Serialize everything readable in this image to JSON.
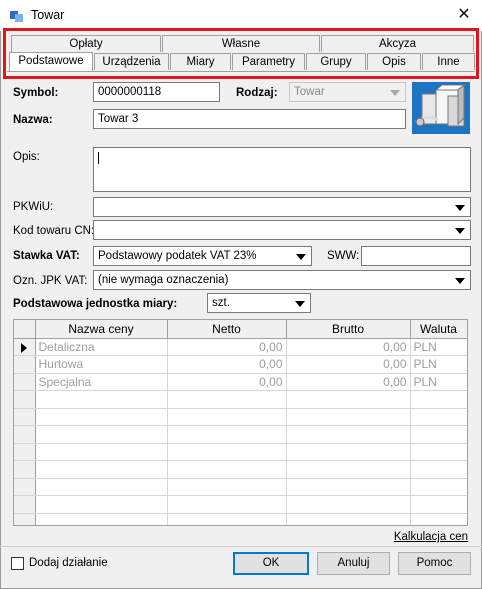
{
  "window": {
    "title": "Towar",
    "close_glyph": "✕"
  },
  "tabs_row1": [
    "Opłaty",
    "Własne",
    "Akcyza"
  ],
  "tabs_row2": [
    "Podstawowe",
    "Urządzenia",
    "Miary",
    "Parametry",
    "Grupy",
    "Opis",
    "Inne"
  ],
  "active_tab": "Podstawowe",
  "form": {
    "symbol_label": "Symbol:",
    "symbol_value": "0000000118",
    "rodzaj_label": "Rodzaj:",
    "rodzaj_value": "Towar",
    "nazwa_label": "Nazwa:",
    "nazwa_value": "Towar 3",
    "opis_label": "Opis:",
    "opis_value": "",
    "pkwiu_label": "PKWiU:",
    "pkwiu_value": "",
    "cn_label": "Kod towaru CN:",
    "cn_value": "",
    "vat_label": "Stawka VAT:",
    "vat_value": "Podstawowy podatek VAT 23%",
    "sww_label": "SWW:",
    "sww_value": "",
    "jpk_label": "Ozn. JPK VAT:",
    "jpk_value": "(nie wymaga oznaczenia)",
    "unit_label": "Podstawowa jednostka miary:",
    "unit_value": "szt."
  },
  "price_table": {
    "columns": [
      "Nazwa ceny",
      "Netto",
      "Brutto",
      "Waluta"
    ],
    "rows": [
      [
        "Detaliczna",
        "0,00",
        "0,00",
        "PLN"
      ],
      [
        "Hurtowa",
        "0,00",
        "0,00",
        "PLN"
      ],
      [
        "Specjalna",
        "0,00",
        "0,00",
        "PLN"
      ]
    ],
    "empty_rows": 8
  },
  "footer": {
    "kalkulacja_link": "Kalkulacja cen",
    "add_action_label": "Dodaj działanie",
    "ok_label": "OK",
    "cancel_label": "Anuluj",
    "help_label": "Pomoc"
  },
  "colors": {
    "highlight_outline": "#e0151e",
    "default_button_border": "#0078d7"
  }
}
